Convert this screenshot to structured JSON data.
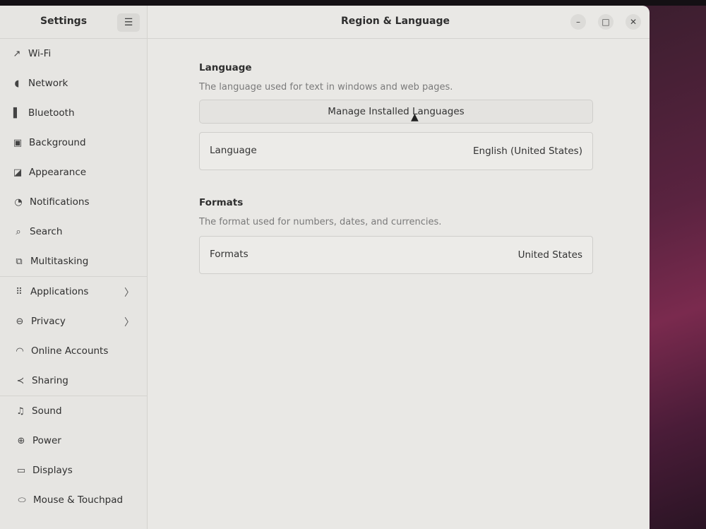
{
  "sidebar": {
    "title": "Settings",
    "search_icon": "search-icon",
    "menu_icon": "☰",
    "items": [
      {
        "label": "Wi-Fi",
        "icon": "↗"
      },
      {
        "label": "Network",
        "icon": "◖"
      },
      {
        "label": "Bluetooth",
        "icon": "▌"
      },
      {
        "label": "Background",
        "icon": "▣"
      },
      {
        "label": "Appearance",
        "icon": "◪"
      },
      {
        "label": "Notifications",
        "icon": "◔"
      },
      {
        "label": "Search",
        "icon": "⌕"
      },
      {
        "label": "Multitasking",
        "icon": "⧉"
      },
      {
        "label": "Applications",
        "icon": "⠿",
        "chevron": "〉"
      },
      {
        "label": "Privacy",
        "icon": "⊖",
        "chevron": "〉"
      },
      {
        "label": "Online Accounts",
        "icon": "◠"
      },
      {
        "label": "Sharing",
        "icon": "≺"
      },
      {
        "label": "Sound",
        "icon": "♫"
      },
      {
        "label": "Power",
        "icon": "⊕"
      },
      {
        "label": "Displays",
        "icon": "▭"
      },
      {
        "label": "Mouse & Touchpad",
        "icon": "⬭"
      }
    ]
  },
  "header": {
    "title": "Region & Language",
    "minimize": "–",
    "maximize": "□",
    "close": "✕"
  },
  "language": {
    "title": "Language",
    "description": "The language used for text in windows and web pages.",
    "manage_button": "Manage Installed Languages",
    "row_label": "Language",
    "row_value": "English (United States)"
  },
  "formats": {
    "title": "Formats",
    "description": "The format used for numbers, dates, and currencies.",
    "row_label": "Formats",
    "row_value": "United States"
  },
  "cursor": "▲"
}
